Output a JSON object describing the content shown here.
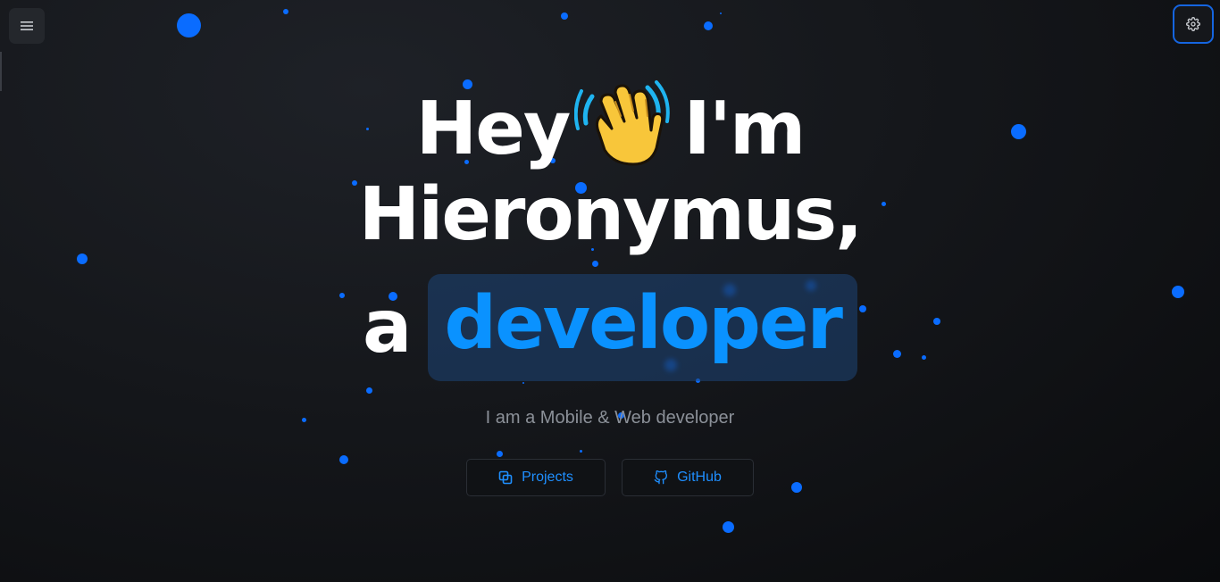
{
  "header": {
    "menu_icon": "hamburger-menu-icon",
    "settings_icon": "gear-icon"
  },
  "hero": {
    "line1_start": "Hey",
    "line1_icon": "waving-hand-emoji",
    "line1_end": "I'm",
    "line2": "Hieronymus,",
    "line3_prefix": "a",
    "line3_highlight": "developer",
    "subtitle": "I am a Mobile & Web developer"
  },
  "buttons": {
    "projects_label": "Projects",
    "projects_icon": "copy-icon",
    "github_label": "GitHub",
    "github_icon": "github-icon"
  },
  "colors": {
    "accent": "#0a92ff",
    "particle": "#0a6cff",
    "background": "#15171b",
    "highlight_bg": "#1e4678"
  }
}
